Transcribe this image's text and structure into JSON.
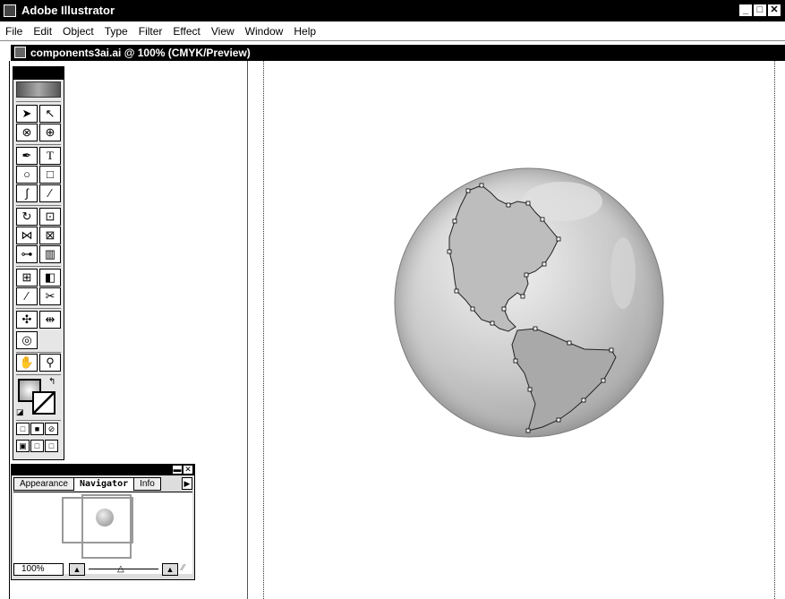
{
  "app": {
    "title": "Adobe Illustrator",
    "window_buttons": [
      "_",
      "□",
      "✕"
    ]
  },
  "menu": [
    "File",
    "Edit",
    "Object",
    "Type",
    "Filter",
    "Effect",
    "View",
    "Window",
    "Help"
  ],
  "document": {
    "title": "components3ai.ai @ 100% (CMYK/Preview)"
  },
  "navigator": {
    "tabs": [
      "Appearance",
      "Navigator",
      "Info"
    ],
    "active_tab": "Navigator",
    "zoom": "100%"
  },
  "icons": {
    "toolbox": [
      "selection-arrow",
      "direct-selection",
      "lasso",
      "direct-lasso",
      "pen",
      "type",
      "ellipse",
      "rectangle",
      "paintbrush",
      "pencil",
      "rotate",
      "scale",
      "reflect",
      "free-transform",
      "blend",
      "graph",
      "mesh",
      "gradient",
      "eyedropper",
      "scissors",
      "symbol-sprayer",
      "width",
      "spiral",
      "hand",
      "zoom"
    ]
  },
  "colors": {
    "title_bg": "#000000",
    "globe_light": "#ececec",
    "globe_dark": "#a8a8a8"
  }
}
